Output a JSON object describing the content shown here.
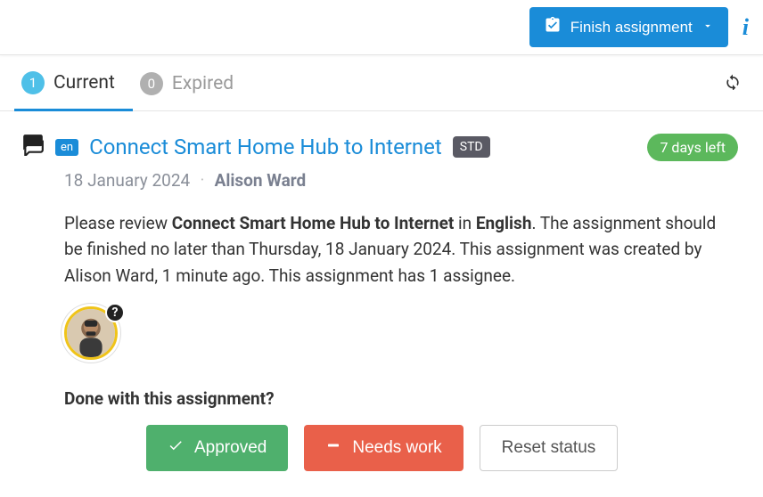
{
  "topbar": {
    "finish_label": "Finish assignment"
  },
  "tabs": {
    "current": {
      "count": "1",
      "label": "Current"
    },
    "expired": {
      "count": "0",
      "label": "Expired"
    }
  },
  "assignment": {
    "lang": "en",
    "title": "Connect Smart Home Hub to Internet",
    "tag": "STD",
    "days_left": "7 days left",
    "date": "18 January 2024",
    "author": "Alison Ward",
    "desc_prefix": "Please review ",
    "desc_title": "Connect Smart Home Hub to Internet",
    "desc_in": " in ",
    "desc_lang": "English",
    "desc_rest": ". The assignment should be finished no later than Thursday, 18 January 2024. This assignment was created by Alison Ward, 1 minute ago. This assignment has 1 assignee.",
    "done_label": "Done with this assignment?",
    "btn_approved": "Approved",
    "btn_needs": "Needs work",
    "btn_reset": "Reset status",
    "avatar_status": "?"
  }
}
